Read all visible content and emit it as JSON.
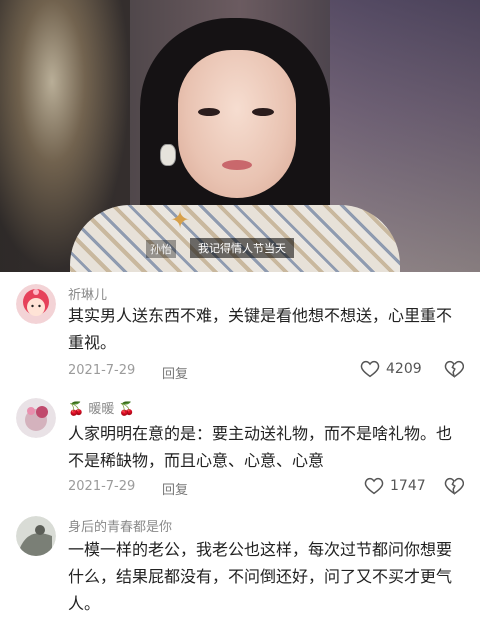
{
  "video": {
    "subtitle_name": "孙怡",
    "subtitle_text": "我记得情人节当天"
  },
  "comments": [
    {
      "username": "祈琳儿",
      "text": [
        "其实男人送东西不难，关键是看他想不想送，心里重不",
        "重视。"
      ],
      "date": "2021-7-29",
      "reply_label": "回复",
      "likes": "4209"
    },
    {
      "username": "暖暖",
      "username_emoji": "🍒",
      "text": [
        "人家明明在意的是：要主动送礼物，而不是啥礼物。也",
        "不是稀缺物，而且心意、心意、心意"
      ],
      "date": "2021-7-29",
      "reply_label": "回复",
      "likes": "1747"
    },
    {
      "username": "身后的青春都是你",
      "text": [
        "一模一样的老公，我老公也这样，每次过节都问你想要",
        "什么，结果屁都没有，不问倒还好，问了又不买才更气",
        "人。"
      ]
    }
  ],
  "colors": {
    "heart_stroke": "#555555",
    "username": "#8a8a8a",
    "body": "#222222"
  }
}
